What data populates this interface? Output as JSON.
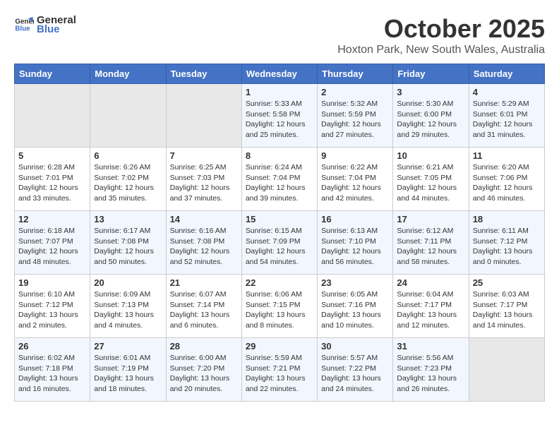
{
  "header": {
    "logo_general": "General",
    "logo_blue": "Blue",
    "month": "October 2025",
    "location": "Hoxton Park, New South Wales, Australia"
  },
  "weekdays": [
    "Sunday",
    "Monday",
    "Tuesday",
    "Wednesday",
    "Thursday",
    "Friday",
    "Saturday"
  ],
  "weeks": [
    [
      {
        "day": "",
        "info": ""
      },
      {
        "day": "",
        "info": ""
      },
      {
        "day": "",
        "info": ""
      },
      {
        "day": "1",
        "info": "Sunrise: 5:33 AM\nSunset: 5:58 PM\nDaylight: 12 hours\nand 25 minutes."
      },
      {
        "day": "2",
        "info": "Sunrise: 5:32 AM\nSunset: 5:59 PM\nDaylight: 12 hours\nand 27 minutes."
      },
      {
        "day": "3",
        "info": "Sunrise: 5:30 AM\nSunset: 6:00 PM\nDaylight: 12 hours\nand 29 minutes."
      },
      {
        "day": "4",
        "info": "Sunrise: 5:29 AM\nSunset: 6:01 PM\nDaylight: 12 hours\nand 31 minutes."
      }
    ],
    [
      {
        "day": "5",
        "info": "Sunrise: 6:28 AM\nSunset: 7:01 PM\nDaylight: 12 hours\nand 33 minutes."
      },
      {
        "day": "6",
        "info": "Sunrise: 6:26 AM\nSunset: 7:02 PM\nDaylight: 12 hours\nand 35 minutes."
      },
      {
        "day": "7",
        "info": "Sunrise: 6:25 AM\nSunset: 7:03 PM\nDaylight: 12 hours\nand 37 minutes."
      },
      {
        "day": "8",
        "info": "Sunrise: 6:24 AM\nSunset: 7:04 PM\nDaylight: 12 hours\nand 39 minutes."
      },
      {
        "day": "9",
        "info": "Sunrise: 6:22 AM\nSunset: 7:04 PM\nDaylight: 12 hours\nand 42 minutes."
      },
      {
        "day": "10",
        "info": "Sunrise: 6:21 AM\nSunset: 7:05 PM\nDaylight: 12 hours\nand 44 minutes."
      },
      {
        "day": "11",
        "info": "Sunrise: 6:20 AM\nSunset: 7:06 PM\nDaylight: 12 hours\nand 46 minutes."
      }
    ],
    [
      {
        "day": "12",
        "info": "Sunrise: 6:18 AM\nSunset: 7:07 PM\nDaylight: 12 hours\nand 48 minutes."
      },
      {
        "day": "13",
        "info": "Sunrise: 6:17 AM\nSunset: 7:08 PM\nDaylight: 12 hours\nand 50 minutes."
      },
      {
        "day": "14",
        "info": "Sunrise: 6:16 AM\nSunset: 7:08 PM\nDaylight: 12 hours\nand 52 minutes."
      },
      {
        "day": "15",
        "info": "Sunrise: 6:15 AM\nSunset: 7:09 PM\nDaylight: 12 hours\nand 54 minutes."
      },
      {
        "day": "16",
        "info": "Sunrise: 6:13 AM\nSunset: 7:10 PM\nDaylight: 12 hours\nand 56 minutes."
      },
      {
        "day": "17",
        "info": "Sunrise: 6:12 AM\nSunset: 7:11 PM\nDaylight: 12 hours\nand 58 minutes."
      },
      {
        "day": "18",
        "info": "Sunrise: 6:11 AM\nSunset: 7:12 PM\nDaylight: 13 hours\nand 0 minutes."
      }
    ],
    [
      {
        "day": "19",
        "info": "Sunrise: 6:10 AM\nSunset: 7:12 PM\nDaylight: 13 hours\nand 2 minutes."
      },
      {
        "day": "20",
        "info": "Sunrise: 6:09 AM\nSunset: 7:13 PM\nDaylight: 13 hours\nand 4 minutes."
      },
      {
        "day": "21",
        "info": "Sunrise: 6:07 AM\nSunset: 7:14 PM\nDaylight: 13 hours\nand 6 minutes."
      },
      {
        "day": "22",
        "info": "Sunrise: 6:06 AM\nSunset: 7:15 PM\nDaylight: 13 hours\nand 8 minutes."
      },
      {
        "day": "23",
        "info": "Sunrise: 6:05 AM\nSunset: 7:16 PM\nDaylight: 13 hours\nand 10 minutes."
      },
      {
        "day": "24",
        "info": "Sunrise: 6:04 AM\nSunset: 7:17 PM\nDaylight: 13 hours\nand 12 minutes."
      },
      {
        "day": "25",
        "info": "Sunrise: 6:03 AM\nSunset: 7:17 PM\nDaylight: 13 hours\nand 14 minutes."
      }
    ],
    [
      {
        "day": "26",
        "info": "Sunrise: 6:02 AM\nSunset: 7:18 PM\nDaylight: 13 hours\nand 16 minutes."
      },
      {
        "day": "27",
        "info": "Sunrise: 6:01 AM\nSunset: 7:19 PM\nDaylight: 13 hours\nand 18 minutes."
      },
      {
        "day": "28",
        "info": "Sunrise: 6:00 AM\nSunset: 7:20 PM\nDaylight: 13 hours\nand 20 minutes."
      },
      {
        "day": "29",
        "info": "Sunrise: 5:59 AM\nSunset: 7:21 PM\nDaylight: 13 hours\nand 22 minutes."
      },
      {
        "day": "30",
        "info": "Sunrise: 5:57 AM\nSunset: 7:22 PM\nDaylight: 13 hours\nand 24 minutes."
      },
      {
        "day": "31",
        "info": "Sunrise: 5:56 AM\nSunset: 7:23 PM\nDaylight: 13 hours\nand 26 minutes."
      },
      {
        "day": "",
        "info": ""
      }
    ]
  ]
}
